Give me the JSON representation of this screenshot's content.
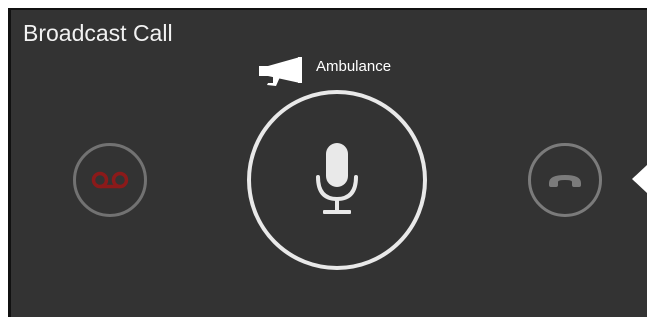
{
  "window": {
    "title": "Broadcast Call"
  },
  "channel": {
    "label": "Ambulance",
    "icon": "megaphone-icon"
  },
  "controls": {
    "voicemail_icon": "voicemail-icon",
    "mic_icon": "microphone-icon",
    "hangup_icon": "phone-hangup-icon",
    "side_arrow_icon": "caret-left-icon"
  },
  "colors": {
    "background": "#333333",
    "voicemail_accent": "#8b1a1a",
    "hangup_icon": "#7b7b7b",
    "mic": "#e9e9e9"
  }
}
